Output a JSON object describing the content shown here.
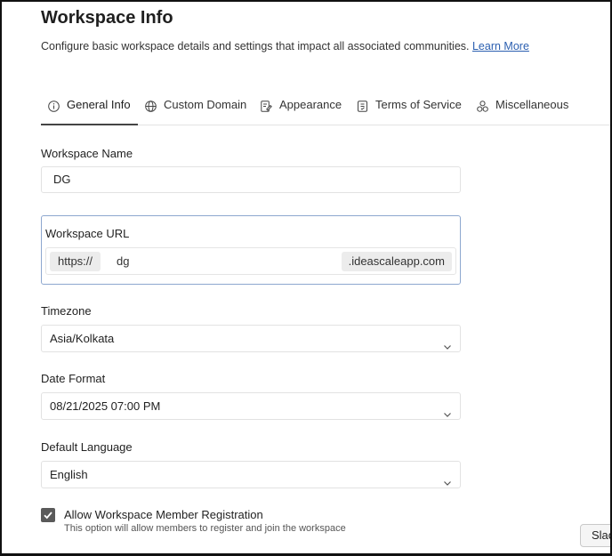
{
  "page": {
    "title": "Workspace Info",
    "description": "Configure basic workspace details and settings that impact all associated communities.",
    "learn_more": "Learn More"
  },
  "tabs": [
    {
      "label": "General Info",
      "icon": "info-icon",
      "active": true
    },
    {
      "label": "Custom Domain",
      "icon": "globe-icon"
    },
    {
      "label": "Appearance",
      "icon": "palette-icon"
    },
    {
      "label": "Terms of Service",
      "icon": "document-icon"
    },
    {
      "label": "Miscellaneous",
      "icon": "shapes-icon"
    }
  ],
  "form": {
    "workspace_name": {
      "label": "Workspace Name",
      "value": "DG"
    },
    "workspace_url": {
      "label": "Workspace URL",
      "prefix": "https://",
      "value": "dg",
      "suffix": ".ideascaleapp.com"
    },
    "timezone": {
      "label": "Timezone",
      "value": "Asia/Kolkata"
    },
    "date_format": {
      "label": "Date Format",
      "value": "08/21/2025 07:00 PM"
    },
    "default_language": {
      "label": "Default Language",
      "value": "English"
    },
    "member_registration": {
      "label": "Allow Workspace Member Registration",
      "help": "This option will allow members to register and join the workspace",
      "checked": true
    }
  },
  "floating": {
    "slack_label": "Slac"
  },
  "colors": {
    "link": "#2b5fb0",
    "focus_border": "#8da7cf",
    "checkbox": "#5a5a5a"
  }
}
